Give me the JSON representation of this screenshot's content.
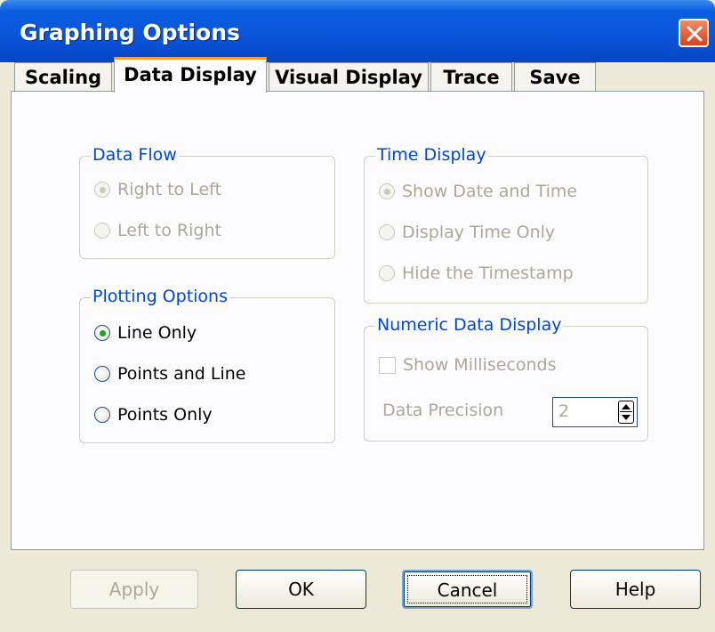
{
  "window": {
    "title": "Graphing Options"
  },
  "tabs": [
    {
      "label": "Scaling"
    },
    {
      "label": "Data Display"
    },
    {
      "label": "Visual Display"
    },
    {
      "label": "Trace"
    },
    {
      "label": "Save"
    }
  ],
  "active_tab": "Data Display",
  "data_flow": {
    "title": "Data Flow",
    "options": [
      {
        "label": "Right to Left"
      },
      {
        "label": "Left to Right"
      }
    ],
    "selected": "Right to Left",
    "enabled": false
  },
  "time_display": {
    "title": "Time Display",
    "options": [
      {
        "label": "Show Date and Time"
      },
      {
        "label": "Display Time Only"
      },
      {
        "label": "Hide the Timestamp"
      }
    ],
    "selected": "Show Date and Time",
    "enabled": false
  },
  "plotting_options": {
    "title": "Plotting Options",
    "options": [
      {
        "label": "Line Only"
      },
      {
        "label": "Points and Line"
      },
      {
        "label": "Points Only"
      }
    ],
    "selected": "Line Only",
    "enabled": true
  },
  "numeric_display": {
    "title": "Numeric Data Display",
    "show_ms_label": "Show Milliseconds",
    "show_ms_checked": false,
    "precision_label": "Data Precision",
    "precision_value": "2",
    "enabled": false
  },
  "buttons": {
    "apply": "Apply",
    "ok": "OK",
    "cancel": "Cancel",
    "help": "Help"
  },
  "colors": {
    "accent": "#0046d5",
    "title_bar": "#0a54d8",
    "selected_radio": "#21a121",
    "tab_highlight": "#f0a030"
  }
}
